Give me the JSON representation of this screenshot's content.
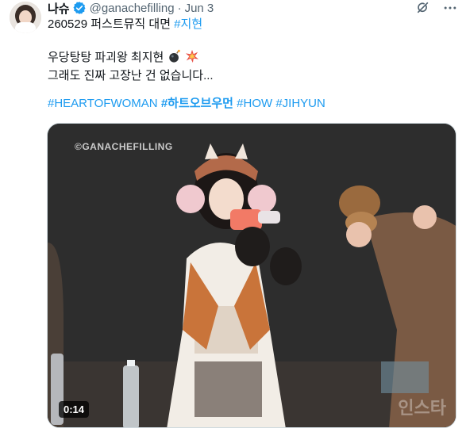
{
  "author": {
    "name": "나슈",
    "handle": "@ganachefilling",
    "separator": "·",
    "date": "Jun 3",
    "verified": true
  },
  "tweet": {
    "line1_text": "260529 퍼스트뮤직 대면 ",
    "line1_tag": "#지현",
    "line2": "우당탕탕 파괴왕 최지현",
    "line3": "그래도 진짜 고장난 건 없습니다...",
    "hashtags": [
      "#HEARTOFWOMAN",
      "#하트오브우먼",
      "#HOW",
      "#JIHYUN"
    ]
  },
  "media": {
    "watermark": "©GANACHEFILLING",
    "duration": "0:14",
    "corner_logo": "인스타"
  },
  "icons": {
    "grok": "grok-icon",
    "more": "more-icon",
    "verified": "verified-badge-icon"
  },
  "colors": {
    "link": "#1d9bf0",
    "secondary": "#536471",
    "verified": "#1d9bf0"
  }
}
